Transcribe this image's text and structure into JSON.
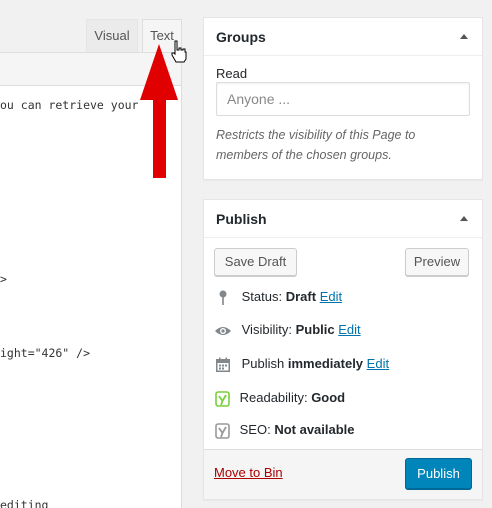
{
  "editor": {
    "tabs": {
      "visual": "Visual",
      "text": "Text"
    },
    "code_lines": [
      "ou can retrieve your",
      ">",
      "ight=\"426\" />",
      " editing"
    ]
  },
  "groups_box": {
    "title": "Groups",
    "read_label": "Read",
    "input_placeholder": "Anyone ...",
    "description": "Restricts the visibility of this Page to members of the chosen groups."
  },
  "publish_box": {
    "title": "Publish",
    "save_draft": "Save Draft",
    "preview": "Preview",
    "status": {
      "label": "Status:",
      "value": "Draft",
      "edit": "Edit"
    },
    "visibility": {
      "label": "Visibility:",
      "value": "Public",
      "edit": "Edit"
    },
    "schedule": {
      "label": "Publish",
      "value": "immediately",
      "edit": "Edit"
    },
    "readability": {
      "label": "Readability:",
      "value": "Good"
    },
    "seo": {
      "label": "SEO:",
      "value": "Not available"
    },
    "move_to_bin": "Move to Bin",
    "publish": "Publish"
  },
  "colors": {
    "accent": "#0085ba",
    "link": "#0073aa",
    "danger": "#a00000",
    "arrow": "#e00000",
    "yoast_good": "#7ad03a"
  }
}
